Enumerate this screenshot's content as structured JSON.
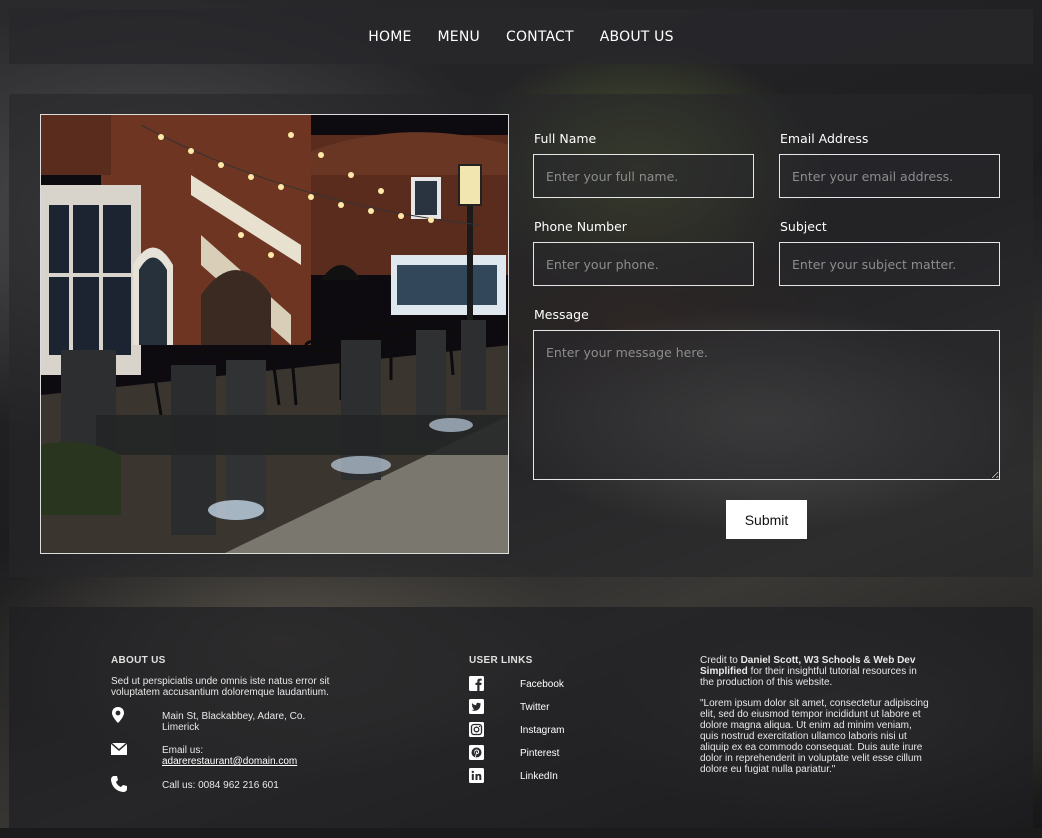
{
  "nav": {
    "items": [
      {
        "label": "HOME"
      },
      {
        "label": "MENU"
      },
      {
        "label": "CONTACT"
      },
      {
        "label": "ABOUT US"
      }
    ]
  },
  "form": {
    "full_name": {
      "label": "Full Name",
      "placeholder": "Enter your full name."
    },
    "email": {
      "label": "Email Address",
      "placeholder": "Enter your email address."
    },
    "phone": {
      "label": "Phone Number",
      "placeholder": "Enter your phone."
    },
    "subject": {
      "label": "Subject",
      "placeholder": "Enter your subject matter."
    },
    "message": {
      "label": "Message",
      "placeholder": "Enter your message here."
    },
    "submit_label": "Submit"
  },
  "footer": {
    "about": {
      "heading": "ABOUT US",
      "text": "Sed ut perspiciatis unde omnis iste natus error sit voluptatem accusantium doloremque laudantium.",
      "address": "Main St, Blackabbey, Adare, Co. Limerick",
      "email_label": "Email us:",
      "email": "adarerestaurant@domain.com",
      "phone": "Call us: 0084 962 216 601"
    },
    "links": {
      "heading": "USER LINKS",
      "items": [
        {
          "label": "Facebook",
          "icon": "facebook-icon"
        },
        {
          "label": "Twitter",
          "icon": "twitter-icon"
        },
        {
          "label": "Instagram",
          "icon": "instagram-icon"
        },
        {
          "label": "Pinterest",
          "icon": "pinterest-icon"
        },
        {
          "label": "LinkedIn",
          "icon": "linkedin-icon"
        }
      ]
    },
    "credit": {
      "prefix": "Credit to ",
      "names": "Daniel Scott, W3 Schools & Web Dev Simplified",
      "suffix": " for their insightful tutorial resources in the production of this website.",
      "quote": "\"Lorem ipsum dolor sit amet, consectetur adipiscing elit, sed do eiusmod tempor incididunt ut labore et dolore magna aliqua. Ut enim ad minim veniam, quis nostrud exercitation ullamco laboris nisi ut aliquip ex ea commodo consequat. Duis aute irure dolor in reprehenderit in voluptate velit esse cillum dolore eu fugiat nulla pariatur.\""
    }
  }
}
